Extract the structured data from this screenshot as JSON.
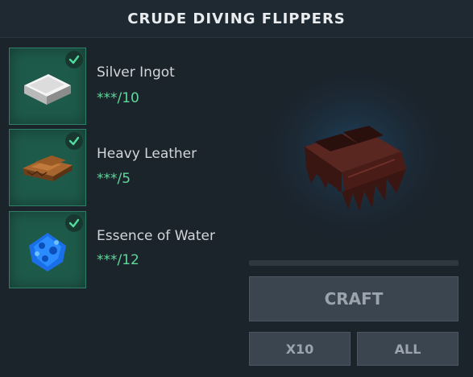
{
  "header": {
    "title": "CRUDE DIVING FLIPPERS"
  },
  "ingredients": [
    {
      "name": "Silver Ingot",
      "quantity": "***/10",
      "icon": "silver-ingot-icon",
      "met": true
    },
    {
      "name": "Heavy Leather",
      "quantity": "***/5",
      "icon": "heavy-leather-icon",
      "met": true
    },
    {
      "name": "Essence of Water",
      "quantity": "***/12",
      "icon": "essence-of-water-icon",
      "met": true
    }
  ],
  "preview": {
    "item_icon": "crude-diving-flippers-icon"
  },
  "crafting": {
    "progress": 0
  },
  "buttons": {
    "craft": "CRAFT",
    "x10": "X10",
    "all": "ALL"
  },
  "colors": {
    "background": "#1b232b",
    "slot_green": "#1e5a4a",
    "check_green": "#4fdc9c",
    "quantity_green": "#5fd99a",
    "button_gray": "#3a4550",
    "button_text": "#9ba4ac"
  }
}
